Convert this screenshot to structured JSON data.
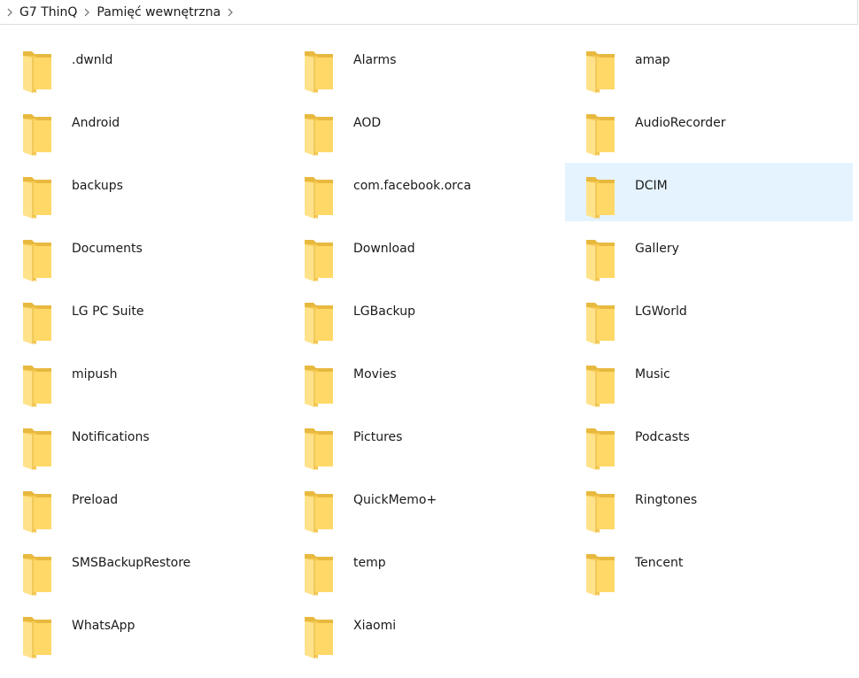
{
  "breadcrumb": {
    "items": [
      "G7 ThinQ",
      "Pamięć wewnętrzna"
    ]
  },
  "colors": {
    "folder_back": "#e8b93f",
    "folder_front": "#ffd867",
    "selected_bg": "#e5f3ff"
  },
  "folders": [
    {
      "name": ".dwnld"
    },
    {
      "name": "Alarms"
    },
    {
      "name": "amap"
    },
    {
      "name": "Android"
    },
    {
      "name": "AOD"
    },
    {
      "name": "AudioRecorder"
    },
    {
      "name": "backups"
    },
    {
      "name": "com.facebook.orca"
    },
    {
      "name": "DCIM",
      "selected": true
    },
    {
      "name": "Documents"
    },
    {
      "name": "Download"
    },
    {
      "name": "Gallery"
    },
    {
      "name": "LG PC Suite"
    },
    {
      "name": "LGBackup"
    },
    {
      "name": "LGWorld"
    },
    {
      "name": "mipush"
    },
    {
      "name": "Movies"
    },
    {
      "name": "Music"
    },
    {
      "name": "Notifications"
    },
    {
      "name": "Pictures"
    },
    {
      "name": "Podcasts"
    },
    {
      "name": "Preload"
    },
    {
      "name": "QuickMemo+"
    },
    {
      "name": "Ringtones"
    },
    {
      "name": "SMSBackupRestore"
    },
    {
      "name": "temp"
    },
    {
      "name": "Tencent"
    },
    {
      "name": "WhatsApp"
    },
    {
      "name": "Xiaomi"
    }
  ]
}
